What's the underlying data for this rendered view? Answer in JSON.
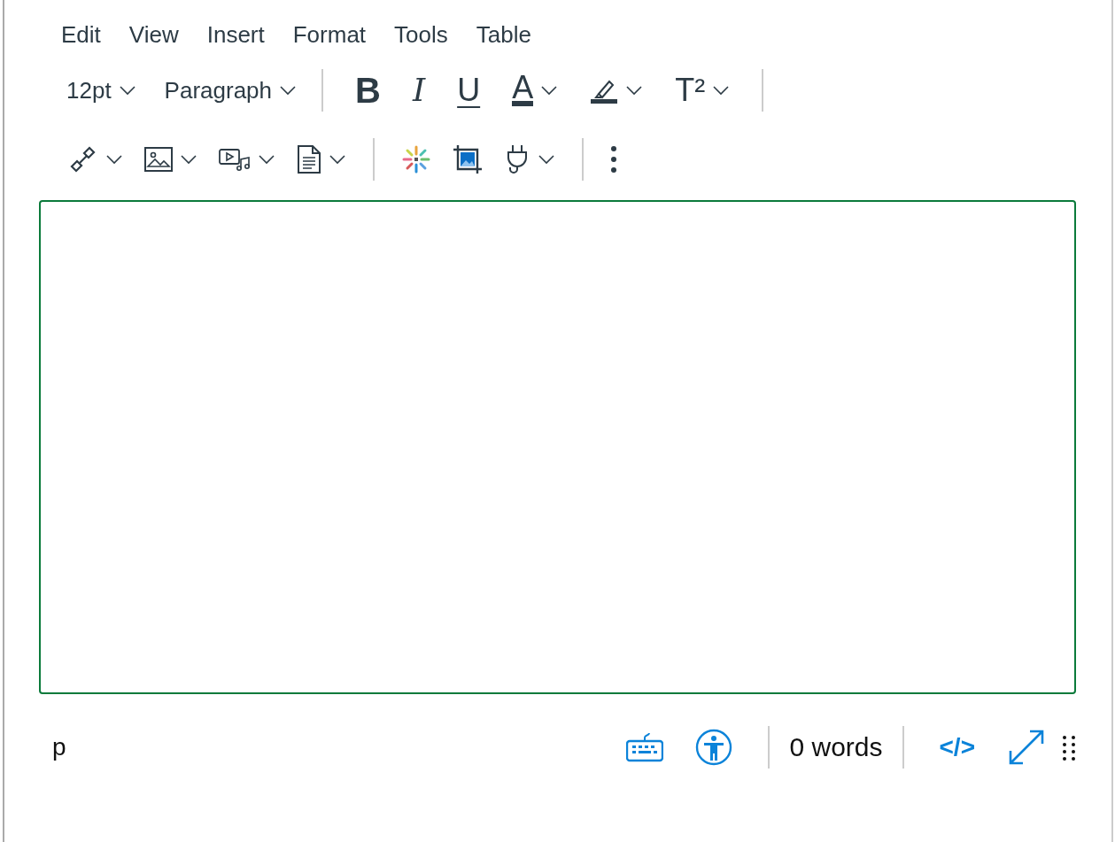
{
  "menu": [
    "Edit",
    "View",
    "Insert",
    "Format",
    "Tools",
    "Table"
  ],
  "toolbar": {
    "font_size": "12pt",
    "block_format": "Paragraph",
    "format_buttons": [
      {
        "kind": "bold",
        "glyph": "B"
      },
      {
        "kind": "italic",
        "glyph": "I"
      },
      {
        "kind": "underline",
        "glyph": "U"
      },
      {
        "kind": "text-color",
        "glyph": "A"
      },
      {
        "kind": "highlight"
      },
      {
        "kind": "superscript",
        "glyph": "T²"
      }
    ]
  },
  "editor": {
    "focused": true
  },
  "status_bar": {
    "path": "p",
    "word_count": "0 words",
    "html_toggle": "</>"
  }
}
